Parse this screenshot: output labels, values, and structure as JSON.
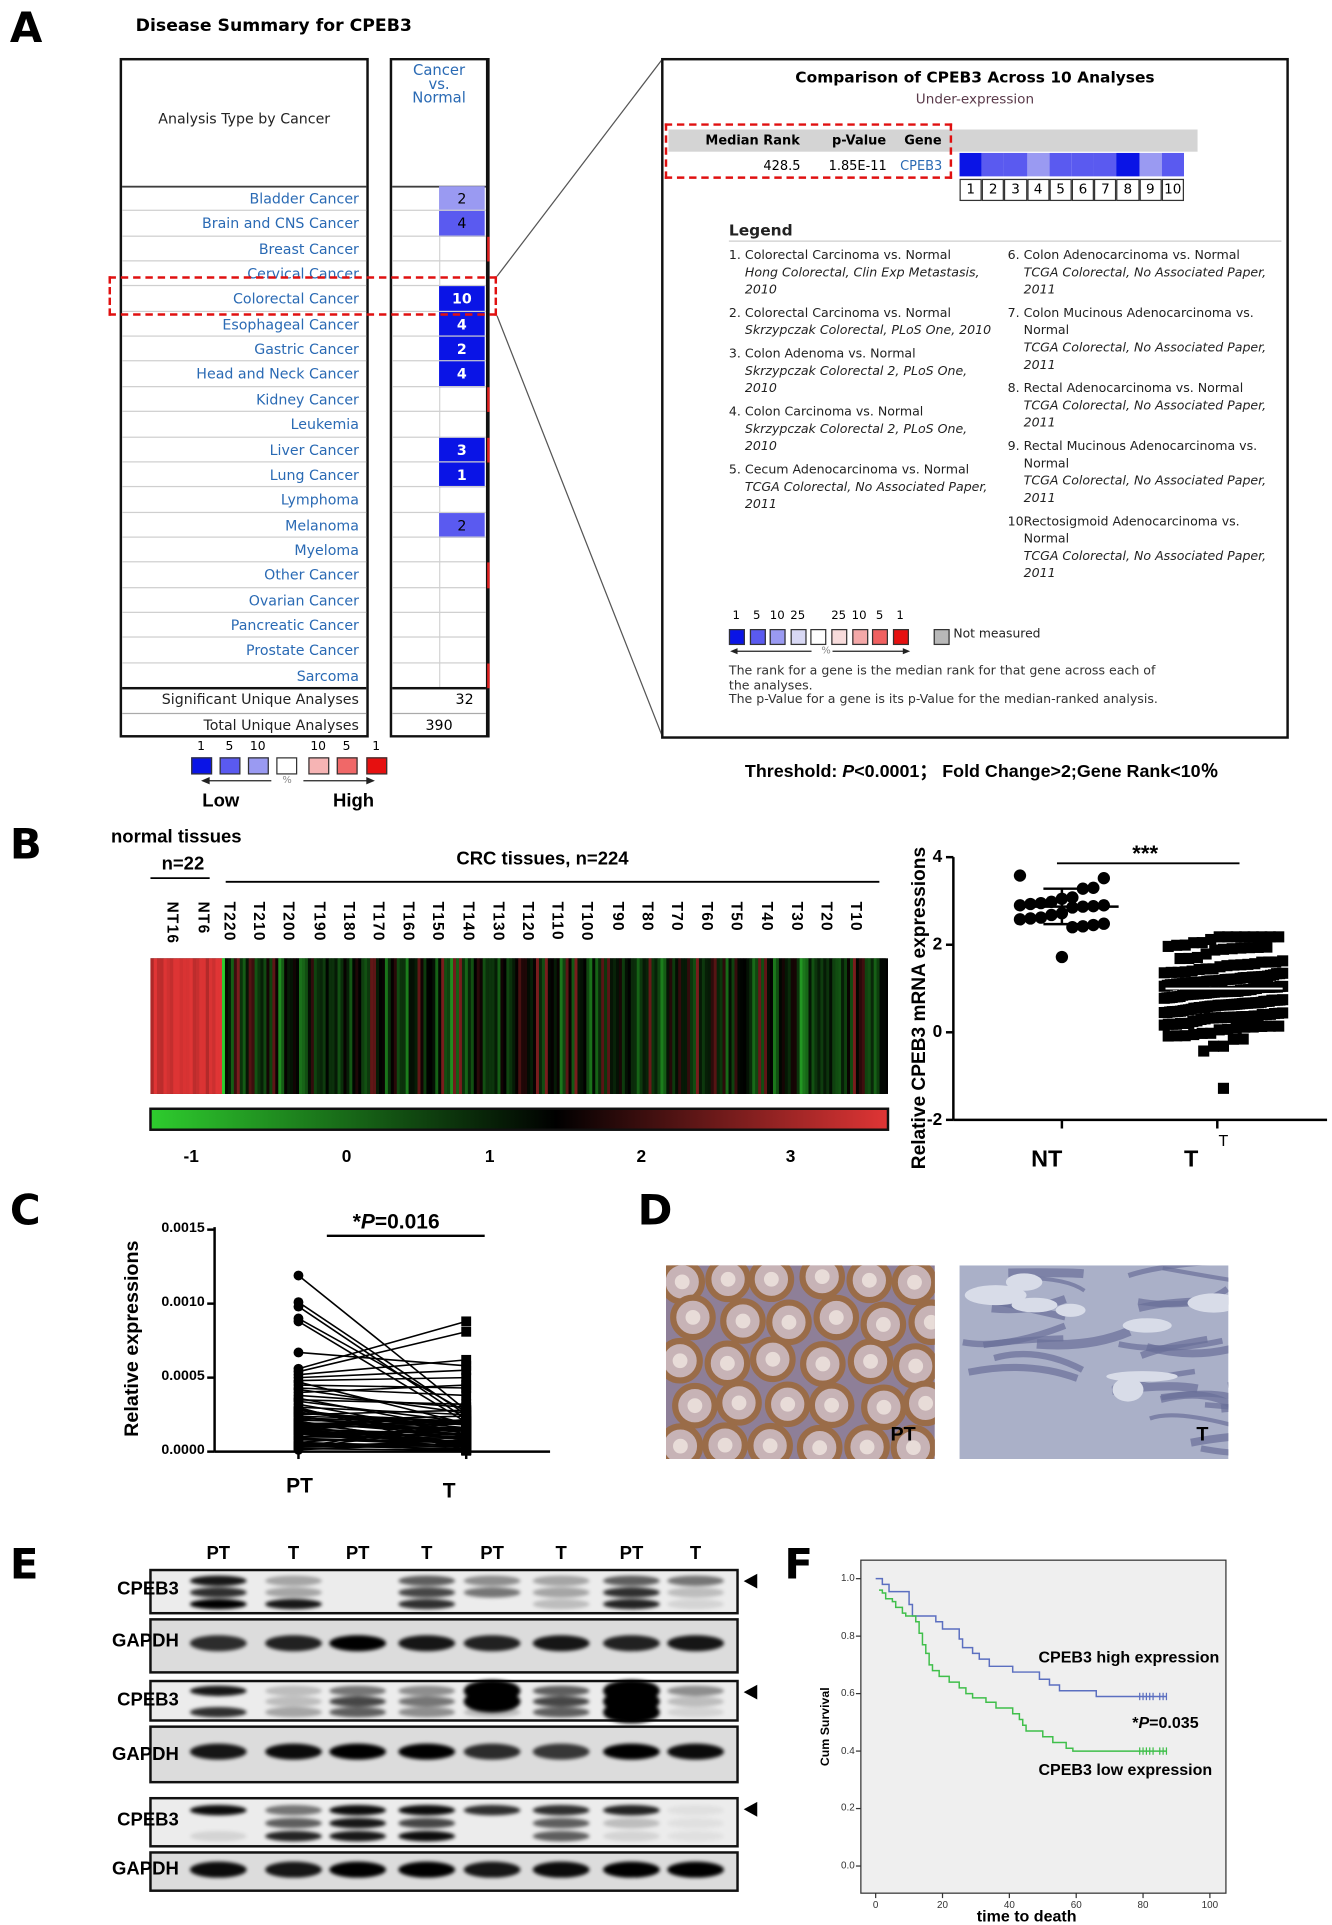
{
  "panel_labels": {
    "a": "A",
    "b": "B",
    "c": "C",
    "d": "D",
    "e": "E",
    "f": "F"
  },
  "colors": {
    "link_blue": "#2a6ab4",
    "under_strong": "#0a14e6",
    "under_mid": "#5a5af0",
    "under_light": "#9a9af2",
    "over_flag": "#e02020",
    "dashed_highlight": "#e01010",
    "km_high": "#5b6fc0",
    "km_low": "#3fbf4a"
  },
  "panel_a": {
    "title": "Disease Summary for CPEB3",
    "header_left": "Analysis Type by Cancer",
    "header_right": [
      "Cancer",
      "vs.",
      "Normal"
    ],
    "rows": [
      {
        "name": "Bladder Cancer",
        "count": "2",
        "shade": "light",
        "over": false
      },
      {
        "name": "Brain and CNS Cancer",
        "count": "4",
        "shade": "mid",
        "over": false
      },
      {
        "name": "Breast Cancer",
        "count": "",
        "shade": "",
        "over": true
      },
      {
        "name": "Cervical Cancer",
        "count": "",
        "shade": "",
        "over": false
      },
      {
        "name": "Colorectal Cancer",
        "count": "10",
        "shade": "strong",
        "over": false,
        "highlighted": true
      },
      {
        "name": "Esophageal Cancer",
        "count": "4",
        "shade": "strong",
        "over": false
      },
      {
        "name": "Gastric Cancer",
        "count": "2",
        "shade": "strong",
        "over": false
      },
      {
        "name": "Head and Neck Cancer",
        "count": "4",
        "shade": "strong",
        "over": false
      },
      {
        "name": "Kidney Cancer",
        "count": "",
        "shade": "",
        "over": true
      },
      {
        "name": "Leukemia",
        "count": "",
        "shade": "",
        "over": false
      },
      {
        "name": "Liver Cancer",
        "count": "3",
        "shade": "strong",
        "over": true
      },
      {
        "name": "Lung Cancer",
        "count": "1",
        "shade": "strong",
        "over": false
      },
      {
        "name": "Lymphoma",
        "count": "",
        "shade": "",
        "over": false
      },
      {
        "name": "Melanoma",
        "count": "2",
        "shade": "mid",
        "over": false
      },
      {
        "name": "Myeloma",
        "count": "",
        "shade": "",
        "over": false
      },
      {
        "name": "Other Cancer",
        "count": "",
        "shade": "",
        "over": true
      },
      {
        "name": "Ovarian Cancer",
        "count": "",
        "shade": "",
        "over": false
      },
      {
        "name": "Pancreatic Cancer",
        "count": "",
        "shade": "",
        "over": false
      },
      {
        "name": "Prostate Cancer",
        "count": "",
        "shade": "",
        "over": false
      },
      {
        "name": "Sarcoma",
        "count": "",
        "shade": "",
        "over": true
      }
    ],
    "significant_label": "Significant Unique Analyses",
    "significant_value": "32",
    "total_label": "Total Unique Analyses",
    "total_value": "390",
    "scale": {
      "numbers": [
        "1",
        "5",
        "10",
        "",
        "10",
        "5",
        "1"
      ],
      "colors": [
        "#0a14e6",
        "#5a5af0",
        "#9a9af2",
        "#ffffff",
        "#f6b4b4",
        "#f06868",
        "#e61010"
      ],
      "pct": "%",
      "low": "Low",
      "high": "High"
    },
    "threshold": {
      "prefix": "Threshold: ",
      "p": "P",
      "rest": "<0.0001；  Fold Change>2;Gene Rank<10％"
    }
  },
  "comparison": {
    "title": "Comparison of CPEB3 Across 10 Analyses",
    "subtitle": "Under-expression",
    "columns": [
      "Median Rank",
      "p-Value",
      "Gene"
    ],
    "median_rank": "428.5",
    "p_value": "1.85E-11",
    "gene": "CPEB3",
    "cells": [
      {
        "n": "1",
        "shade": "strong"
      },
      {
        "n": "2",
        "shade": "mid"
      },
      {
        "n": "3",
        "shade": "mid"
      },
      {
        "n": "4",
        "shade": "light"
      },
      {
        "n": "5",
        "shade": "mid"
      },
      {
        "n": "6",
        "shade": "mid"
      },
      {
        "n": "7",
        "shade": "mid"
      },
      {
        "n": "8",
        "shade": "strong"
      },
      {
        "n": "9",
        "shade": "light"
      },
      {
        "n": "10",
        "shade": "mid"
      }
    ],
    "legend_title": "Legend",
    "legend_left": [
      {
        "n": "1.",
        "title": "Colorectal Carcinoma vs. Normal",
        "source": "Hong Colorectal, Clin Exp Metastasis, 2010"
      },
      {
        "n": "2.",
        "title": "Colorectal Carcinoma vs. Normal",
        "source": "Skrzypczak Colorectal, PLoS One, 2010"
      },
      {
        "n": "3.",
        "title": "Colon Adenoma vs. Normal",
        "source": "Skrzypczak Colorectal 2, PLoS One, 2010"
      },
      {
        "n": "4.",
        "title": "Colon Carcinoma vs. Normal",
        "source": "Skrzypczak Colorectal 2, PLoS One, 2010"
      },
      {
        "n": "5.",
        "title": "Cecum Adenocarcinoma vs. Normal",
        "source": "TCGA Colorectal, No Associated Paper, 2011"
      }
    ],
    "legend_right": [
      {
        "n": "6.",
        "title": "Colon Adenocarcinoma vs. Normal",
        "source": "TCGA Colorectal, No Associated Paper, 2011"
      },
      {
        "n": "7.",
        "title": "Colon Mucinous Adenocarcinoma vs. Normal",
        "source": "TCGA Colorectal, No Associated Paper, 2011"
      },
      {
        "n": "8.",
        "title": "Rectal Adenocarcinoma vs. Normal",
        "source": "TCGA Colorectal, No Associated Paper, 2011"
      },
      {
        "n": "9.",
        "title": "Rectal Mucinous Adenocarcinoma vs. Normal",
        "source": "TCGA Colorectal, No Associated Paper, 2011"
      },
      {
        "n": "10.",
        "title": "Rectosigmoid Adenocarcinoma vs. Normal",
        "source": "TCGA Colorectal, No Associated Paper, 2011"
      }
    ],
    "key_numbers": [
      "1",
      "5",
      "10",
      "25",
      "",
      "25",
      "10",
      "5",
      "1"
    ],
    "key_colors": [
      "#0a14e6",
      "#5a5af0",
      "#9a9af2",
      "#d8d8f4",
      "#ffffff",
      "#f8dcdc",
      "#f4a8a8",
      "#f06060",
      "#e61010"
    ],
    "key_pct": "%",
    "not_measured": "Not measured",
    "note_lines": [
      "The rank for a gene is the median rank for that gene across each of",
      "the analyses.",
      "The p-Value for a gene is its p-Value for the median-ranked analysis."
    ]
  },
  "chart_data": [
    {
      "type": "heatmap",
      "group_labels": {
        "normal_title": "normal tissues",
        "normal_n": "n=22",
        "tumor": "CRC tissues, n=224"
      },
      "column_labels": [
        "NT16",
        "NT6",
        "T220",
        "T210",
        "T200",
        "T190",
        "T180",
        "T170",
        "T160",
        "T150",
        "T140",
        "T130",
        "T120",
        "T110",
        "T100",
        "T90",
        "T80",
        "T70",
        "T60",
        "T50",
        "T40",
        "T30",
        "T20",
        "T10"
      ],
      "colorbar": {
        "range": [
          -1,
          3
        ],
        "ticks": [
          "-1",
          "0",
          "1",
          "2",
          "3"
        ],
        "low_color": "#2ecc2e",
        "mid_color": "#000000",
        "high_color": "#e03535"
      },
      "normal_count": 22,
      "tumor_count": 224
    },
    {
      "type": "scatter",
      "ylabel": "Relative CPEB3 mRNA expressions",
      "ylim": [
        -2,
        4
      ],
      "yticks": [
        "4",
        "2",
        "0",
        "-2"
      ],
      "categories": [
        "NT",
        "T"
      ],
      "tick_extra_label": "T",
      "significance": "***",
      "NT": {
        "values": [
          3.58,
          3.52,
          3.3,
          3.28,
          3.08,
          3.05,
          2.98,
          2.95,
          2.93,
          2.9,
          2.9,
          2.88,
          2.87,
          2.85,
          2.72,
          2.68,
          2.62,
          2.6,
          2.58,
          2.48,
          2.45,
          2.42,
          2.4,
          1.72
        ],
        "mean": 2.87,
        "sd_low": 2.47,
        "sd_high": 3.28
      },
      "T": {
        "n": 224,
        "mean": 0.85,
        "sd": 0.62,
        "min": -1.28,
        "max": 2.18,
        "mean_line": 1.0,
        "sd_low": 0.45,
        "sd_high": 1.5
      }
    },
    {
      "type": "line",
      "ylabel": "Relative expressions",
      "ylim": [
        0,
        0.0015
      ],
      "yticks": [
        "0.0015",
        "0.0010",
        "0.0005",
        "0.0000"
      ],
      "categories": [
        "PT",
        "T"
      ],
      "annotation": {
        "star": "*",
        "p": "P",
        "rest": "=0.016"
      },
      "pairs": [
        [
          0.00119,
          0.00028
        ],
        [
          0.00101,
          0.00025
        ],
        [
          0.00098,
          0.00022
        ],
        [
          0.0009,
          0.00027
        ],
        [
          0.00088,
          0.0002
        ],
        [
          0.00067,
          0.00058
        ],
        [
          0.00056,
          0.00088
        ],
        [
          0.00054,
          0.00081
        ],
        [
          0.00052,
          0.00062
        ],
        [
          0.0005,
          0.00055
        ],
        [
          0.00048,
          0.0005
        ],
        [
          0.00045,
          0.00043
        ],
        [
          0.00043,
          0.00038
        ],
        [
          0.0004,
          0.00045
        ],
        [
          0.00038,
          0.0003
        ],
        [
          0.00036,
          0.00015
        ],
        [
          0.00034,
          0.0002
        ],
        [
          0.00032,
          0.00012
        ],
        [
          0.0003,
          0.00025
        ],
        [
          0.00028,
          0.0001
        ],
        [
          0.00026,
          0.00018
        ],
        [
          0.00024,
          8e-05
        ],
        [
          0.00022,
          0.00014
        ],
        [
          0.0002,
          0.00011
        ],
        [
          0.00019,
          6e-05
        ],
        [
          0.00018,
          0.00016
        ],
        [
          0.00016,
          9e-05
        ],
        [
          0.00015,
          0.00012
        ],
        [
          0.00014,
          5e-05
        ],
        [
          0.00013,
          0.0001
        ],
        [
          0.00012,
          7e-05
        ],
        [
          0.0001,
          9e-05
        ],
        [
          9e-05,
          4e-05
        ],
        [
          8e-05,
          6e-05
        ],
        [
          6e-05,
          3e-05
        ],
        [
          5e-05,
          5e-05
        ],
        [
          4e-05,
          2e-05
        ],
        [
          3e-05,
          4e-05
        ],
        [
          2e-05,
          1e-05
        ],
        [
          0.00035,
          0.00032
        ],
        [
          0.00042,
          0.00026
        ],
        [
          0.00047,
          0.00019
        ],
        [
          0.00025,
          0.00028
        ],
        [
          0.00021,
          0.00024
        ]
      ]
    },
    {
      "type": "line",
      "subtype": "kaplan-meier",
      "xlabel": "time to death",
      "ylabel": "Cum Survival",
      "xlim": [
        0,
        100
      ],
      "ylim": [
        0,
        1
      ],
      "xticks": [
        "0",
        "20",
        "40",
        "60",
        "80",
        "100"
      ],
      "yticks": [
        "0.0",
        "0.2",
        "0.4",
        "0.6",
        "0.8",
        "1.0"
      ],
      "annotation": {
        "star": "*",
        "p": "P",
        "rest": "=0.035"
      },
      "series": [
        {
          "name": "CPEB3 high expression",
          "color": "#5b6fc0",
          "end": 87,
          "censored": [
            79,
            80,
            81,
            82,
            83,
            85,
            86,
            87
          ],
          "steps": [
            [
              0,
              1.0
            ],
            [
              2,
              0.98
            ],
            [
              4,
              0.955
            ],
            [
              10,
              0.91
            ],
            [
              11,
              0.87
            ],
            [
              18,
              0.85
            ],
            [
              20,
              0.825
            ],
            [
              25,
              0.79
            ],
            [
              26,
              0.76
            ],
            [
              29,
              0.74
            ],
            [
              31,
              0.72
            ],
            [
              34,
              0.695
            ],
            [
              41,
              0.675
            ],
            [
              49,
              0.65
            ],
            [
              52,
              0.63
            ],
            [
              55,
              0.61
            ],
            [
              66,
              0.59
            ]
          ]
        },
        {
          "name": "CPEB3 low expression",
          "color": "#3fbf4a",
          "end": 87,
          "censored": [
            79,
            80,
            81,
            82,
            83,
            85,
            86,
            87
          ],
          "steps": [
            [
              1,
              0.96
            ],
            [
              2,
              0.95
            ],
            [
              3,
              0.93
            ],
            [
              5,
              0.92
            ],
            [
              6,
              0.9
            ],
            [
              8,
              0.88
            ],
            [
              9,
              0.87
            ],
            [
              12,
              0.85
            ],
            [
              13,
              0.81
            ],
            [
              14,
              0.77
            ],
            [
              15,
              0.74
            ],
            [
              16,
              0.7
            ],
            [
              17,
              0.68
            ],
            [
              19,
              0.66
            ],
            [
              22,
              0.64
            ],
            [
              25,
              0.62
            ],
            [
              27,
              0.6
            ],
            [
              29,
              0.585
            ],
            [
              33,
              0.57
            ],
            [
              36,
              0.55
            ],
            [
              41,
              0.53
            ],
            [
              43,
              0.51
            ],
            [
              44,
              0.49
            ],
            [
              45,
              0.47
            ],
            [
              50,
              0.45
            ],
            [
              53,
              0.43
            ],
            [
              57,
              0.41
            ],
            [
              59,
              0.4
            ]
          ]
        }
      ]
    }
  ],
  "panel_d": {
    "images": [
      {
        "label": "PT"
      },
      {
        "label": "T"
      }
    ]
  },
  "panel_e": {
    "lanes": [
      "PT",
      "T",
      "PT",
      "T",
      "PT",
      "T",
      "PT",
      "T"
    ],
    "blots": [
      {
        "label": "CPEB3",
        "arrow": true,
        "bands": [
          [
            0.9,
            0.8,
            1.0
          ],
          [
            0.3,
            0.3,
            0.9
          ],
          [
            0,
            0,
            0
          ],
          [
            0.6,
            0.7,
            0.8
          ],
          [
            0.4,
            0.5,
            0
          ],
          [
            0.3,
            0.3,
            0.2
          ],
          [
            0.6,
            0.8,
            0.85
          ],
          [
            0.5,
            0.2,
            0.1
          ]
        ]
      },
      {
        "label": "GAPDH",
        "arrow": false,
        "bands": [
          [
            0.8
          ],
          [
            0.85
          ],
          [
            1
          ],
          [
            0.9
          ],
          [
            0.85
          ],
          [
            0.9
          ],
          [
            0.85
          ],
          [
            0.9
          ]
        ]
      },
      {
        "label": "CPEB3",
        "arrow": true,
        "bands": [
          [
            0.9,
            0,
            0.8
          ],
          [
            0.2,
            0.2,
            0.3
          ],
          [
            0.5,
            0.7,
            0.6
          ],
          [
            0.4,
            0.5,
            0.4
          ],
          [
            1,
            1,
            0.2
          ],
          [
            0.6,
            0.7,
            0.6
          ],
          [
            1,
            1,
            1
          ],
          [
            0.4,
            0.2,
            0.1
          ]
        ]
      },
      {
        "label": "GAPDH",
        "arrow": false,
        "bands": [
          [
            0.9
          ],
          [
            0.95
          ],
          [
            1
          ],
          [
            1
          ],
          [
            0.8
          ],
          [
            0.75
          ],
          [
            1
          ],
          [
            0.95
          ]
        ]
      },
      {
        "label": "CPEB3",
        "arrow": true,
        "bands": [
          [
            0.95,
            0,
            0.1
          ],
          [
            0.5,
            0.6,
            0.85
          ],
          [
            0.95,
            0.9,
            0.9
          ],
          [
            0.95,
            0.7,
            0.95
          ],
          [
            0.8,
            0,
            0
          ],
          [
            0.8,
            0.6,
            0.6
          ],
          [
            0.85,
            0.2,
            0.1
          ],
          [
            0.05,
            0.05,
            0.05
          ]
        ]
      },
      {
        "label": "GAPDH",
        "arrow": false,
        "bands": [
          [
            0.95
          ],
          [
            0.9
          ],
          [
            1
          ],
          [
            1
          ],
          [
            0.9
          ],
          [
            0.95
          ],
          [
            1
          ],
          [
            1
          ]
        ]
      }
    ]
  }
}
